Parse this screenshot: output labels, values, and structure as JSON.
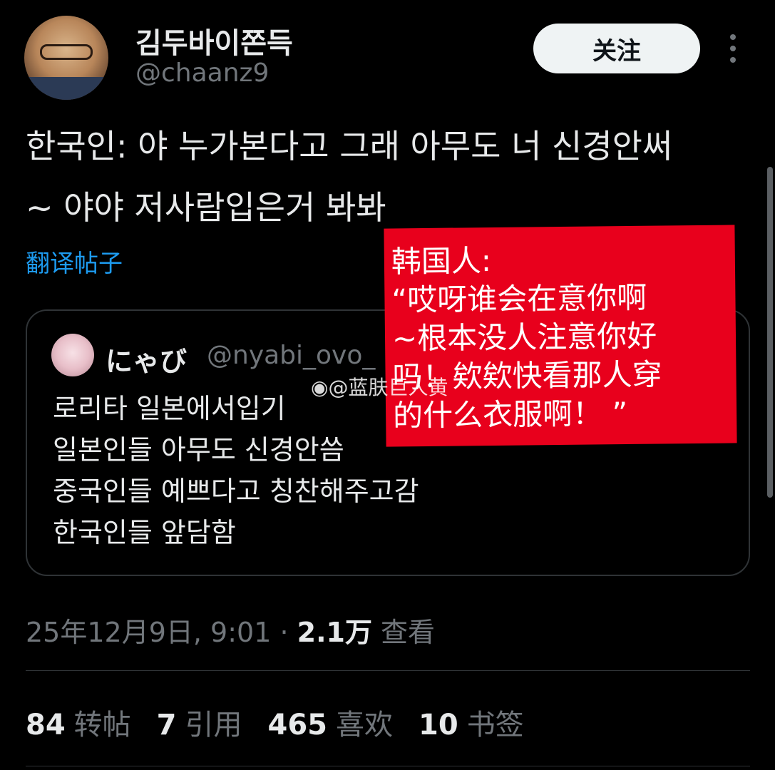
{
  "author": {
    "display_name": "김두바이쫀득",
    "handle": "@chaanz9",
    "follow_label": "关注"
  },
  "post": {
    "text": "한국인: 야 누가본다고 그래 아무도 너 신경안써\n~ 야야 저사람입은거 봐봐",
    "translate_label": "翻译帖子"
  },
  "quote": {
    "name": "にゃび",
    "handle": "@nyabi_ovo_",
    "body": "로리타 일본에서입기\n일본인들 아무도 신경안씀\n중국인들 예쁘다고 칭찬해주고감\n한국인들 앞담함"
  },
  "meta": {
    "timestamp": "25年12月9日, 9:01 · ",
    "views_count": "2.1万",
    "views_label": " 查看"
  },
  "stats": [
    {
      "count": "84",
      "label": "转帖"
    },
    {
      "count": "7",
      "label": "引用"
    },
    {
      "count": "465",
      "label": "喜欢"
    },
    {
      "count": "10",
      "label": "书签"
    }
  ],
  "overlay_note": {
    "text": "韩国人:\n  “哎呀谁会在意你啊\n~根本没人注意你好\n吗！欸欸快看那人穿\n的什么衣服啊！ ”"
  },
  "watermark": "@蓝肤巨人黄",
  "icons": {
    "more": "more-vertical-icon",
    "watermark": "weibo-icon"
  }
}
